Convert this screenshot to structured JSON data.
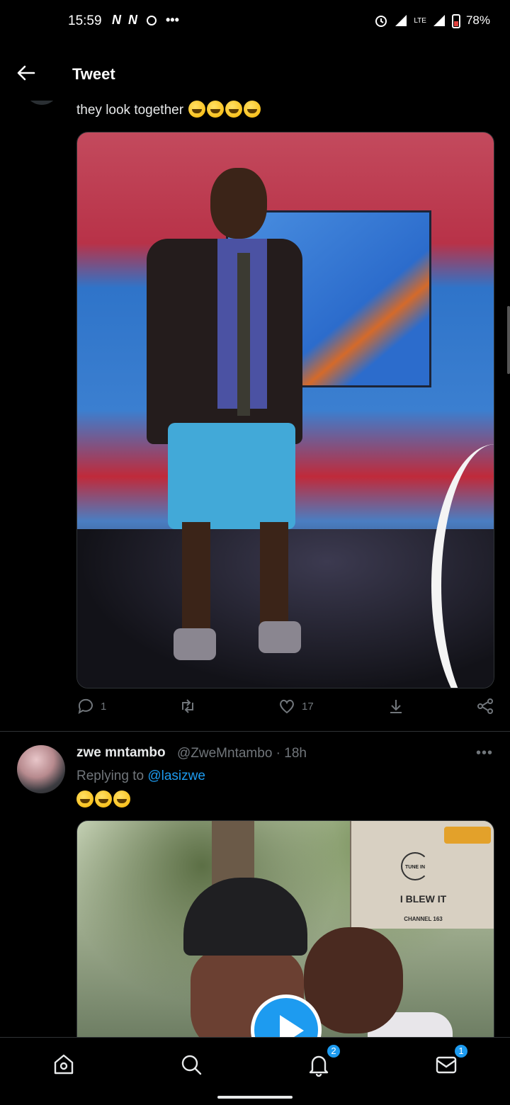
{
  "status_bar": {
    "time": "15:59",
    "left_icons": [
      "N",
      "N"
    ],
    "battery": "78%"
  },
  "header": {
    "title": "Tweet"
  },
  "tweet1": {
    "text": "they look together",
    "emoji_count": 4,
    "actions": {
      "reply_count": "1",
      "like_count": "17"
    }
  },
  "tweet2": {
    "name": "zwe mntambo",
    "handle_time": "@ZweMntambo · 18h",
    "replying_prefix": "Replying to ",
    "replying_mention": "@lasizwe",
    "emoji_count": 3,
    "media_sign": {
      "small_text": "TUNE IN",
      "title": "I BLEW IT",
      "channel": "CHANNEL 163"
    }
  },
  "bottom_nav": {
    "items": [
      "home-icon",
      "search-icon",
      "notifications-icon",
      "messages-icon"
    ],
    "notifications_badge": "2",
    "messages_badge": "1"
  },
  "colors": {
    "accent": "#1d9bf0",
    "background": "#000000",
    "secondary_text": "#71767b"
  }
}
